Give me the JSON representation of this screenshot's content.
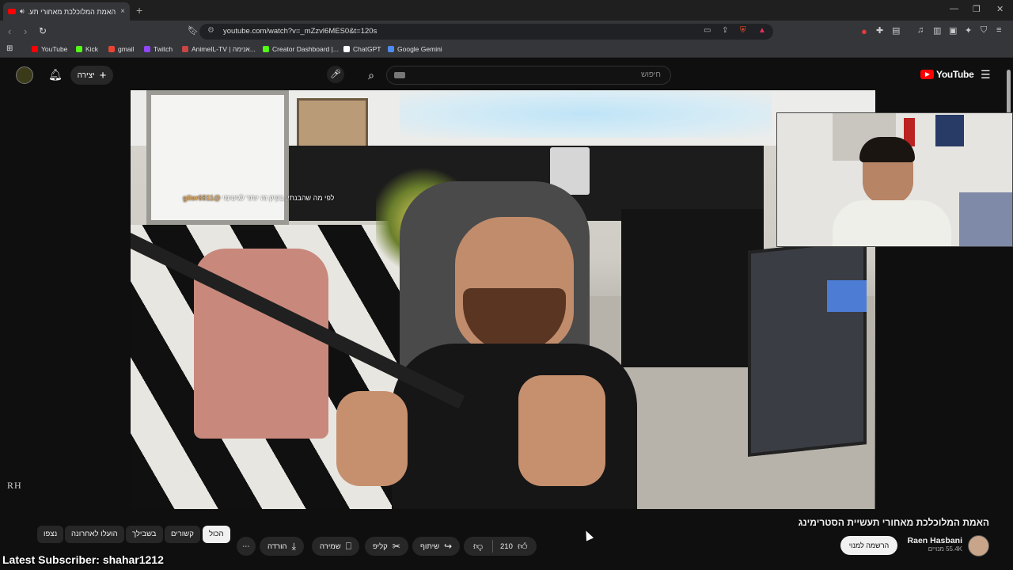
{
  "browser": {
    "tab_title": "האמת המלוכלכת מאחורי תע...",
    "tab_close": "×",
    "new_tab": "+",
    "url": "youtube.com/watch?v=_mZzvl6MES0&t=120s",
    "window_min": "—",
    "window_max": "❐",
    "window_close": "✕"
  },
  "bookmarks": [
    {
      "label": "YouTube",
      "color": "#ff0000"
    },
    {
      "label": "Kick",
      "color": "#53fc18"
    },
    {
      "label": "gmail",
      "color": "#ea4335"
    },
    {
      "label": "Twitch",
      "color": "#9146ff"
    },
    {
      "label": "AnimeIL-TV | אנימה...",
      "color": "#c44"
    },
    {
      "label": "Creator Dashboard |...",
      "color": "#53fc18"
    },
    {
      "label": "ChatGPT",
      "color": "#ffffff"
    },
    {
      "label": "Google Gemini",
      "color": "#4e8cf0"
    }
  ],
  "youtube": {
    "logo": "YouTube",
    "search_placeholder": "חיפוש",
    "create_label": "יצירה"
  },
  "video": {
    "overlay_mention": "@gilor6811",
    "overlay_text": "לפי מה שהבנתי, בקיק זה יותר לגיטימי",
    "watermark": "RH",
    "title": "האמת המלוכלכת מאחורי תעשיית הסטרימינג"
  },
  "channel": {
    "name": "Raen Hasbani",
    "subs": "55.4K מנויים",
    "subscribe": "הרשמה למנוי"
  },
  "actions": {
    "likes": "210",
    "share": "שיתוף",
    "clip": "קליפ",
    "save": "שמירה",
    "download": "הורדה",
    "more": "⋯"
  },
  "chips": [
    "הכול",
    "קשורים",
    "בשבילך",
    "הועלו לאחרונה",
    "נצפו"
  ],
  "overlay_bottom": "Latest Subscriber: shahar1212",
  "colors": {
    "accent": "#ff0000",
    "background": "#0f0f0f"
  }
}
